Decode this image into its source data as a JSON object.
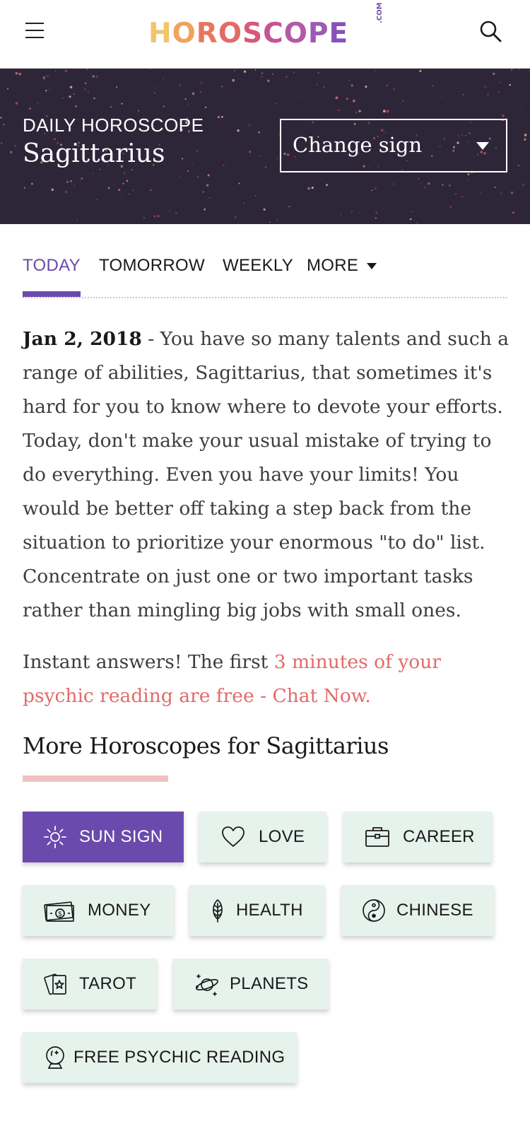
{
  "header": {
    "logo_text": "HOROSCOPE",
    "logo_suffix": ".COM",
    "menu_icon": "hamburger-menu-icon",
    "search_icon": "search-icon",
    "logo_colors": [
      "#f2c46b",
      "#f0a35c",
      "#e8765e",
      "#e26b68",
      "#d9577a",
      "#c5558e",
      "#b45aa5",
      "#9c59b6",
      "#8b4fb8"
    ]
  },
  "hero": {
    "kicker": "DAILY HOROSCOPE",
    "title": "Sagittarius",
    "change_sign_label": "Change sign",
    "background_color": "#2d2639"
  },
  "tabs": {
    "items": [
      {
        "label": "TODAY",
        "active": true
      },
      {
        "label": "TOMORROW",
        "active": false
      },
      {
        "label": "WEEKLY",
        "active": false
      },
      {
        "label": "MORE",
        "active": false
      }
    ]
  },
  "reading": {
    "date": "Jan 2, 2018",
    "text": " - You have so many talents and such a range of abilities, Sagittarius, that sometimes it's hard for you to know where to devote your efforts. Today, don't make your usual mistake of trying to do everything. Even you have your limits! You would be better off taking a step back from the situation to prioritize your enormous \"to do\" list. Concentrate on just one or two important tasks rather than mingling big jobs with small ones."
  },
  "promo": {
    "prefix": "Instant answers! The first ",
    "link": "3 minutes of your psychic reading are free - Chat Now."
  },
  "more_section": {
    "title": "More Horoscopes for Sagittarius",
    "buttons": [
      {
        "label": "SUN SIGN",
        "icon": "sun-icon",
        "active": true
      },
      {
        "label": "LOVE",
        "icon": "heart-icon",
        "active": false
      },
      {
        "label": "CAREER",
        "icon": "briefcase-icon",
        "active": false
      },
      {
        "label": "MONEY",
        "icon": "money-icon",
        "active": false
      },
      {
        "label": "HEALTH",
        "icon": "leaf-icon",
        "active": false
      },
      {
        "label": "CHINESE",
        "icon": "yin-yang-icon",
        "active": false
      },
      {
        "label": "TAROT",
        "icon": "tarot-cards-icon",
        "active": false
      },
      {
        "label": "PLANETS",
        "icon": "planet-icon",
        "active": false
      },
      {
        "label": "FREE PSYCHIC READING",
        "icon": "crystal-ball-icon",
        "active": false
      }
    ]
  },
  "colors": {
    "accent_purple": "#6a4aad",
    "link_coral": "#e26b68",
    "pill_bg": "#e6f2ec",
    "underline_pink": "#f0c1c3"
  }
}
